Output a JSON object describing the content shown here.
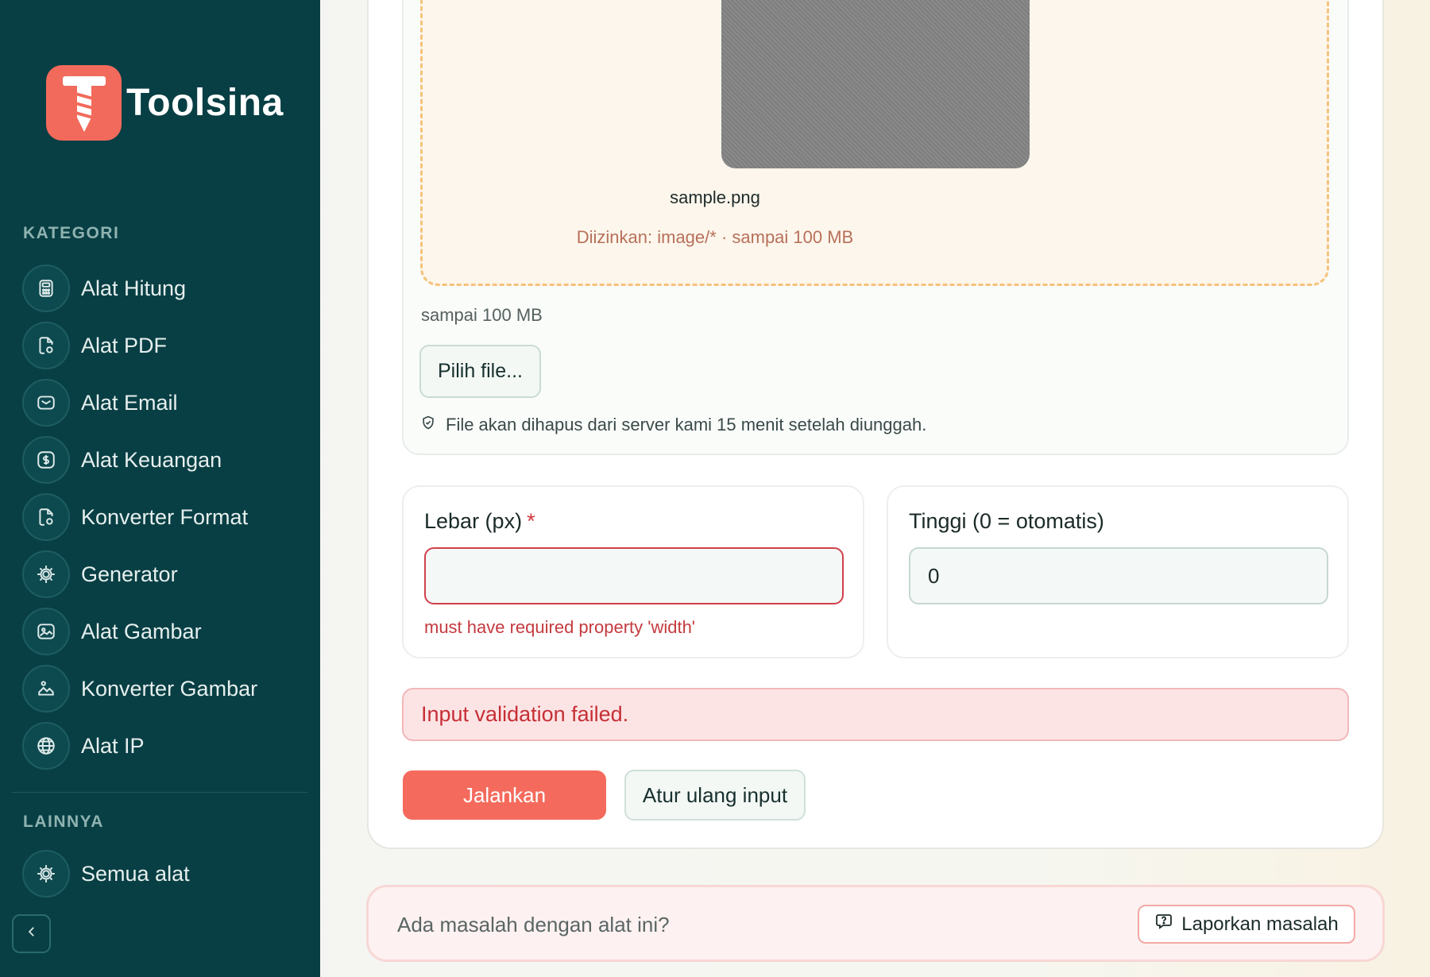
{
  "brand": {
    "name": "Toolsina"
  },
  "sidebar": {
    "category_heading": "KATEGORI",
    "other_heading": "LAINNYA",
    "items": [
      {
        "label": "Alat Hitung",
        "icon": "calculator-icon"
      },
      {
        "label": "Alat PDF",
        "icon": "pdf-file-icon"
      },
      {
        "label": "Alat Email",
        "icon": "mail-icon"
      },
      {
        "label": "Alat Keuangan",
        "icon": "dollar-icon"
      },
      {
        "label": "Konverter Format",
        "icon": "file-convert-icon"
      },
      {
        "label": "Generator",
        "icon": "chip-icon"
      },
      {
        "label": "Alat Gambar",
        "icon": "image-icon"
      },
      {
        "label": "Konverter Gambar",
        "icon": "image-convert-icon"
      },
      {
        "label": "Alat IP",
        "icon": "globe-icon"
      }
    ],
    "other_items": [
      {
        "label": "Semua alat",
        "icon": "chip-icon"
      }
    ]
  },
  "upload": {
    "file_name": "sample.png",
    "allowed_text": "Diizinkan: image/* · sampai 100 MB",
    "limit_text": "sampai 100 MB",
    "pick_button": "Pilih file...",
    "notice": "File akan dihapus dari server kami 15 menit setelah diunggah."
  },
  "fields": {
    "width": {
      "label": "Lebar (px)",
      "required_mark": "*",
      "value": "",
      "error": "must have required property 'width'"
    },
    "height": {
      "label": "Tinggi (0 = otomatis)",
      "value": "0"
    }
  },
  "error_banner": "Input validation failed.",
  "actions": {
    "run": "Jalankan",
    "reset": "Atur ulang input"
  },
  "report": {
    "question": "Ada masalah dengan alat ini?",
    "button": "Laporkan masalah"
  },
  "colors": {
    "sidebar_bg": "#083f44",
    "accent": "#f46b5d",
    "error": "#c62f36"
  }
}
